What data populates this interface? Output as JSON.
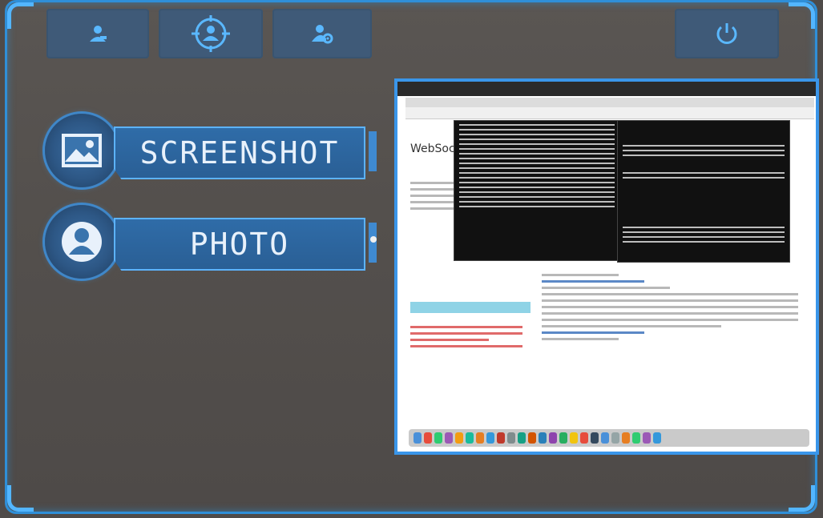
{
  "actions": {
    "screenshot_label": "SCREENSHOT",
    "photo_label": "PHOTO"
  },
  "toolbar": {
    "icons": [
      "user-icon",
      "target-user-icon",
      "user-settings-icon",
      "power-icon"
    ]
  },
  "preview": {
    "page_title": "WebSocket"
  },
  "colors": {
    "accent": "#3a96ea",
    "button_bg": "#3f5a78",
    "label_bg": "#2f6ca8"
  }
}
